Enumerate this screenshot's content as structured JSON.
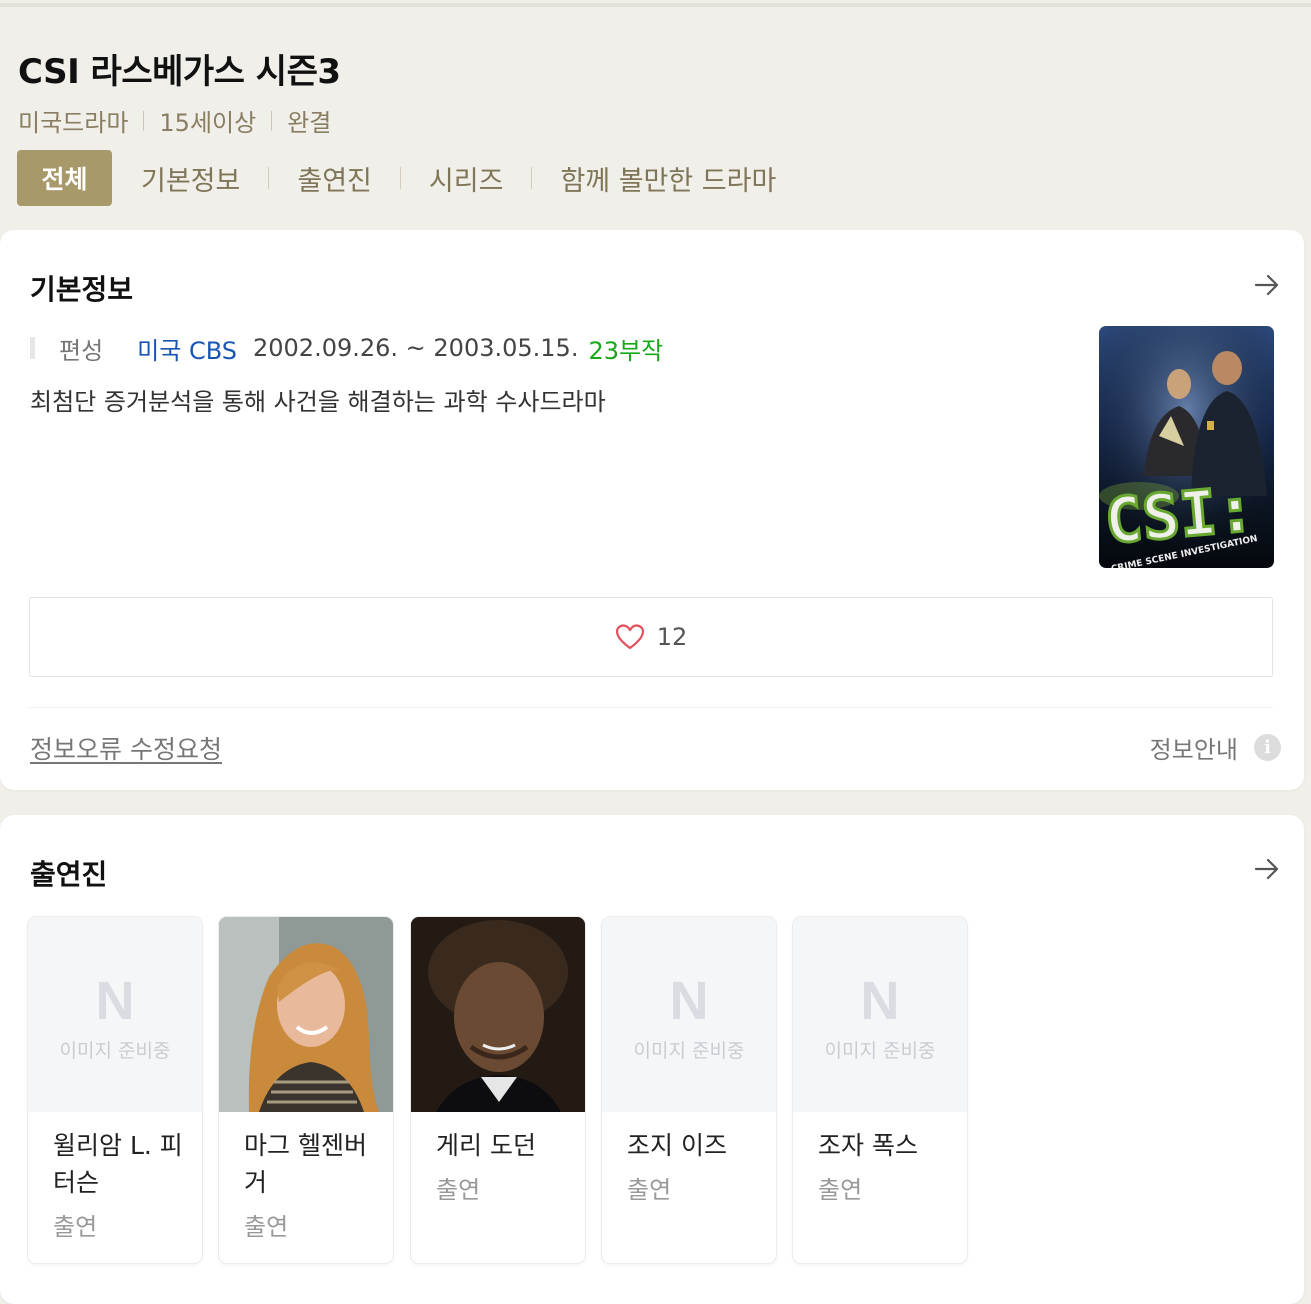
{
  "header": {
    "title": "CSI 라스베가스 시즌3",
    "meta": [
      "미국드라마",
      "15세이상",
      "완결"
    ]
  },
  "tabs": [
    {
      "label": "전체",
      "active": true
    },
    {
      "label": "기본정보",
      "active": false
    },
    {
      "label": "출연진",
      "active": false
    },
    {
      "label": "시리즈",
      "active": false
    },
    {
      "label": "함께 볼만한 드라마",
      "active": false
    }
  ],
  "basic_info": {
    "section_title": "기본정보",
    "label": "편성",
    "network": "미국 CBS",
    "dates": "2002.09.26. ~ 2003.05.15.",
    "episodes": "23부작",
    "description": "최첨단 증거분석을 통해 사건을 해결하는 과학 수사드라마",
    "poster": {
      "logo_text": "CSI:",
      "subtitle_text": "CRIME SCENE INVESTIGATION"
    },
    "like_count": "12",
    "report_link": "정보오류 수정요청",
    "info_guide": "정보안내",
    "info_icon": "i"
  },
  "cast": {
    "section_title": "출연진",
    "placeholder_logo": "N",
    "placeholder_text": "이미지 준비중",
    "members": [
      {
        "name": "윌리암 L. 피터슨",
        "role": "출연",
        "has_photo": false
      },
      {
        "name": "마그 헬젠버거",
        "role": "출연",
        "has_photo": true
      },
      {
        "name": "게리 도던",
        "role": "출연",
        "has_photo": true
      },
      {
        "name": "조지 이즈",
        "role": "출연",
        "has_photo": false
      },
      {
        "name": "조자 폭스",
        "role": "출연",
        "has_photo": false
      }
    ]
  },
  "colors": {
    "page_bg": "#f0efe9",
    "accent": "#a8996b",
    "network_blue": "#1a55b0",
    "episodes_green": "#17a81a",
    "heart": "#e2505c"
  }
}
